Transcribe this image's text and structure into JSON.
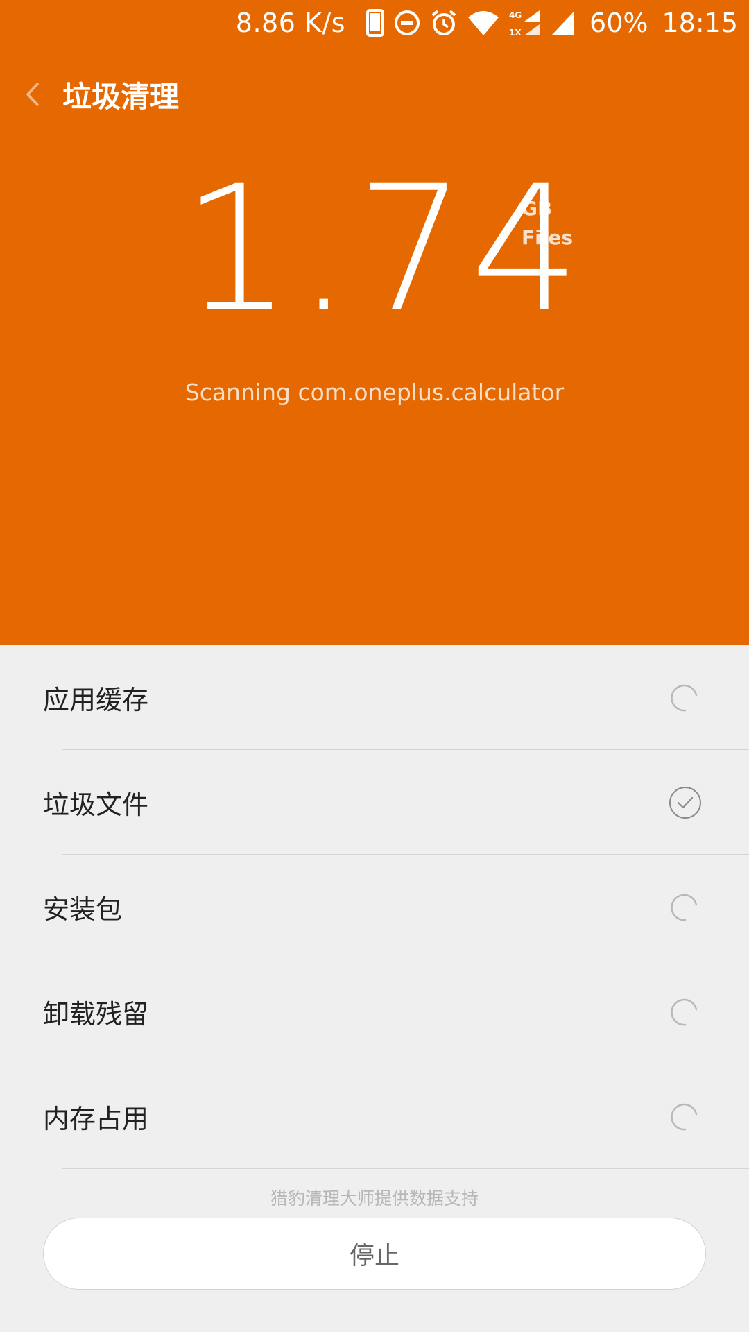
{
  "status_bar": {
    "net_speed": "8.86 K/s",
    "battery": "60%",
    "time": "18:15",
    "icons": [
      "phone-icon",
      "dnd-icon",
      "alarm-icon",
      "wifi-icon",
      "signal-4g-icon",
      "signal-icon"
    ],
    "network_labels": [
      "4G",
      "1X"
    ]
  },
  "header": {
    "back_icon": "chevron-left-icon",
    "title": "垃圾清理"
  },
  "scan": {
    "size_value": "1.74",
    "size_unit": "GB",
    "size_caption": "Files",
    "status_text": "Scanning com.oneplus.calculator"
  },
  "categories": [
    {
      "label": "应用缓存",
      "state": "scanning"
    },
    {
      "label": "垃圾文件",
      "state": "done"
    },
    {
      "label": "安装包",
      "state": "scanning"
    },
    {
      "label": "卸载残留",
      "state": "scanning"
    },
    {
      "label": "内存占用",
      "state": "scanning"
    }
  ],
  "footer": {
    "provider_note": "猎豹清理大师提供数据支持",
    "stop_label": "停止"
  },
  "colors": {
    "accent": "#e56800",
    "background": "#efefef"
  }
}
